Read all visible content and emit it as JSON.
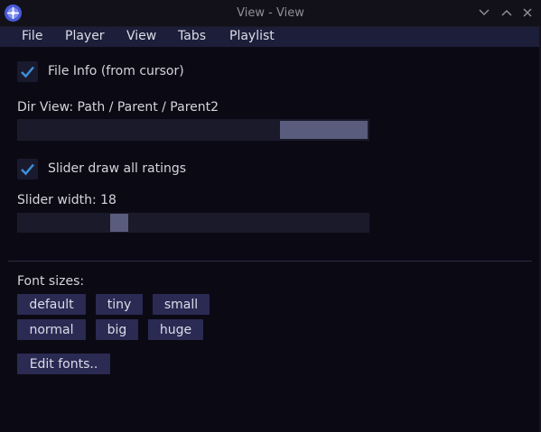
{
  "window": {
    "title": "View - View",
    "app_icon": "disc-icon",
    "controls": [
      "chevron-down-icon",
      "chevron-up-icon",
      "close-icon"
    ]
  },
  "menu": {
    "items": [
      "File",
      "Player",
      "View",
      "Tabs",
      "Playlist"
    ]
  },
  "file_info": {
    "label": "File Info (from cursor)",
    "checked": true
  },
  "dir_view": {
    "label": "Dir View: Path / Parent / Parent2"
  },
  "slider_ratings": {
    "label": "Slider draw all ratings",
    "checked": true
  },
  "slider_width": {
    "label": "Slider width: 18",
    "value": 18
  },
  "font_sizes": {
    "label": "Font sizes:",
    "buttons": [
      "default",
      "tiny",
      "small",
      "normal",
      "big",
      "huge"
    ]
  },
  "edit_fonts": {
    "label": "Edit fonts.."
  },
  "colors": {
    "background": "#0b0a14",
    "menubar": "#1c1e3a",
    "button": "#2b2a53",
    "check": "#3d8fd9",
    "slider_thumb": "#5a5c7d"
  }
}
